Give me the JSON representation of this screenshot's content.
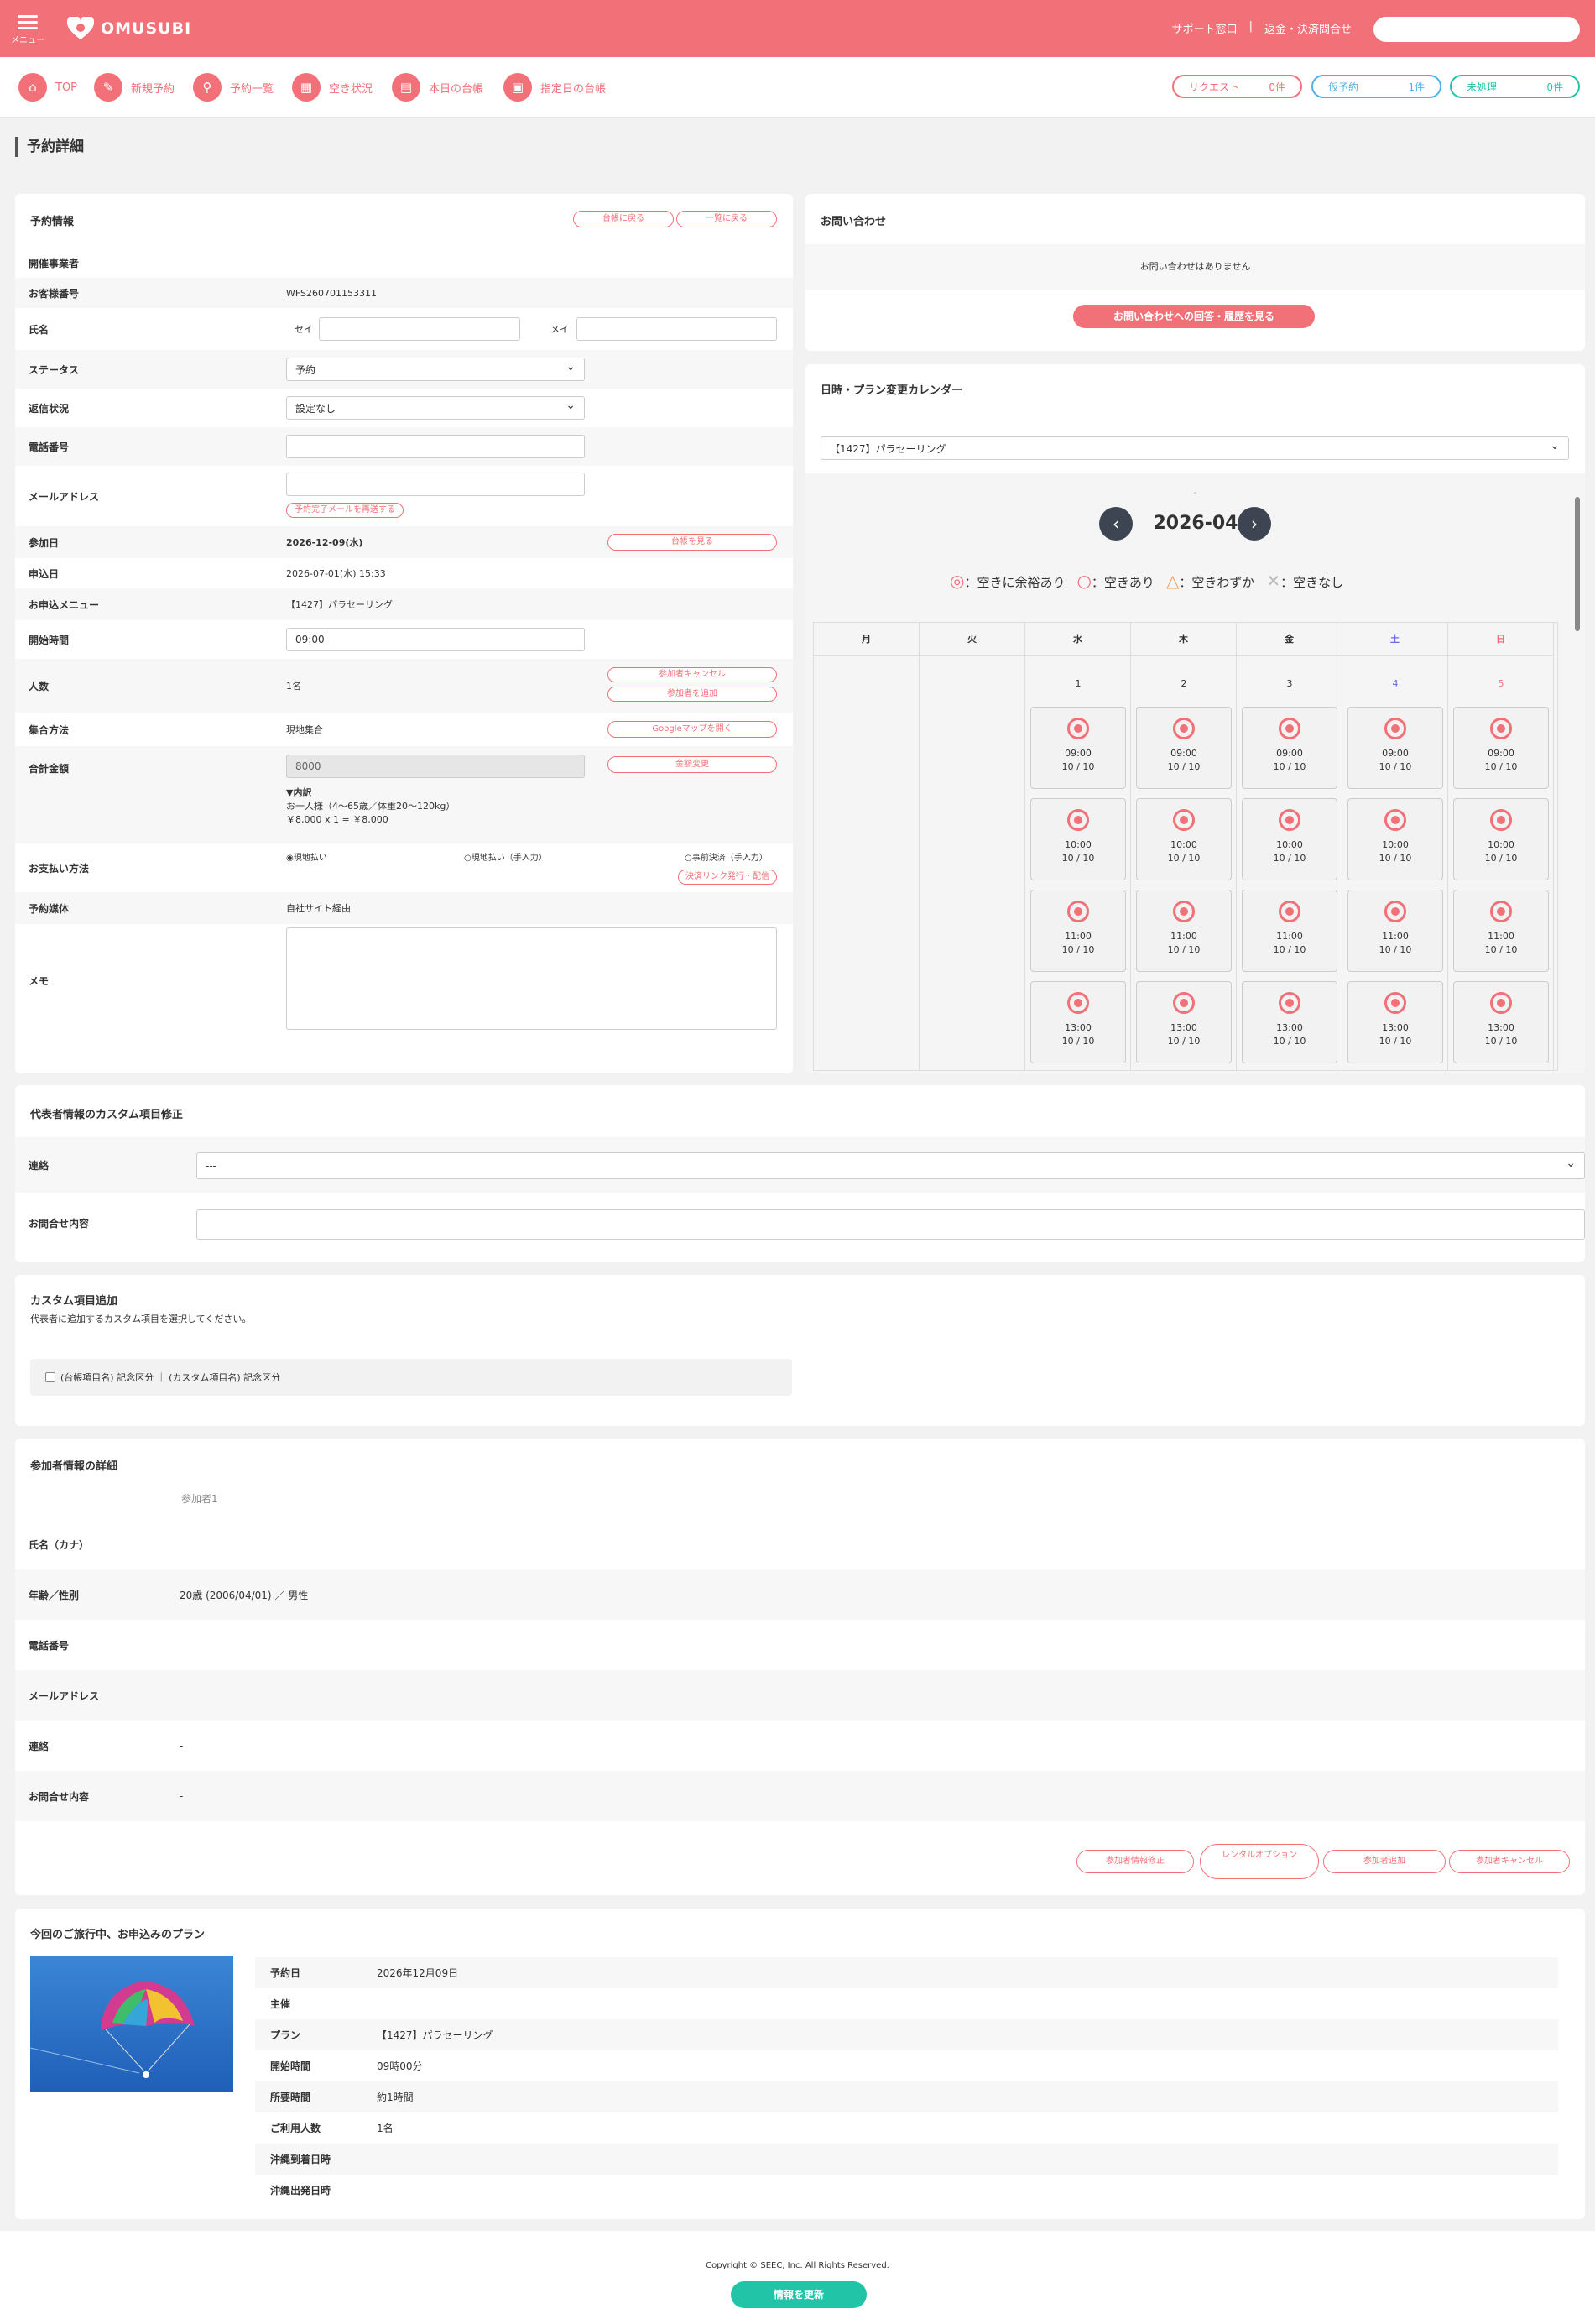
{
  "header": {
    "menu_label": "メニュー",
    "logo_text": "OMUSUBI",
    "support_link": "サポート窓口",
    "separator": "|",
    "refund_link": "返金・決済問合せ",
    "search_placeholder": ""
  },
  "nav": [
    {
      "label": "TOP",
      "icon": "home-icon"
    },
    {
      "label": "新規予約",
      "icon": "edit-icon"
    },
    {
      "label": "予約一覧",
      "icon": "search-icon"
    },
    {
      "label": "空き状況",
      "icon": "grid-icon"
    },
    {
      "label": "本日の台帳",
      "icon": "book-icon"
    },
    {
      "label": "指定日の台帳",
      "icon": "calendar-icon"
    }
  ],
  "badges": [
    {
      "label": "リクエスト",
      "count": "0件",
      "color": "#f27077"
    },
    {
      "label": "仮予約",
      "count": "1件",
      "color": "#4db3e6"
    },
    {
      "label": "未処理",
      "count": "0件",
      "color": "#22c4a8"
    }
  ],
  "page_title": "予約詳細",
  "reservation": {
    "heading": "予約情報",
    "back_ledger": "台帳に戻る",
    "back_list": "一覧に戻る",
    "organizer_label": "開催事業者",
    "customer_no_label": "お客様番号",
    "customer_no": "WFS260701153311",
    "name_label": "氏名",
    "sei_label": "セイ",
    "mei_label": "メイ",
    "status_label": "ステータス",
    "status_value": "予約",
    "reply_label": "返信状況",
    "reply_value": "設定なし",
    "phone_label": "電話番号",
    "email_label": "メールアドレス",
    "resend_mail": "予約完了メールを再送する",
    "date_label": "参加日",
    "date_value": "2026-12-09(水)",
    "see_ledger": "台帳を見る",
    "apply_label": "申込日",
    "apply_value": "2026-07-01(水) 15:33",
    "menu_label": "お申込メニュー",
    "menu_value": "【1427】パラセーリング",
    "start_label": "開始時間",
    "start_value": "09:00",
    "people_label": "人数",
    "people_value": "1名",
    "cancel_participant": "参加者キャンセル",
    "add_participant": "参加者を追加",
    "meet_label": "集合方法",
    "meet_value": "現地集合",
    "google_map": "Googleマップを開く",
    "total_label": "合計金額",
    "total_value": "8000",
    "change_price": "金額変更",
    "breakdown_title": "▼内訳",
    "breakdown_line1": "お一人様（4〜65歳／体重20〜120kg）",
    "breakdown_line2": "￥8,000 x 1 = ￥8,000",
    "pay_label": "お支払い方法",
    "pay_opt1": "現地払い",
    "pay_opt2": "現地払い（手入力）",
    "pay_opt3": "事前決済（手入力）",
    "pay_link": "決済リンク発行・配信",
    "media_label": "予約媒体",
    "media_value": "自社サイト経由",
    "memo_label": "メモ"
  },
  "inquiry": {
    "heading": "お問い合わせ",
    "empty": "お問い合わせはありません",
    "button": "お問い合わせへの回答・履歴を見る"
  },
  "calendar": {
    "heading": "日時・プラン変更カレンダー",
    "plan_select": "【1427】パラセーリング",
    "dash": "-",
    "month": "2026-04",
    "legend": [
      {
        "symbol": "◎",
        "text": "：空きに余裕あり"
      },
      {
        "symbol": "○",
        "text": "：空きあり"
      },
      {
        "symbol": "△",
        "text": "：空きわずか"
      },
      {
        "symbol": "✕",
        "text": "：空きなし"
      }
    ],
    "weekdays": [
      "月",
      "火",
      "水",
      "木",
      "金",
      "土",
      "日"
    ],
    "dates": [
      "1",
      "2",
      "3",
      "4",
      "5"
    ],
    "slots": [
      {
        "time": "09:00",
        "capacity": "10 / 10"
      },
      {
        "time": "10:00",
        "capacity": "10 / 10"
      },
      {
        "time": "11:00",
        "capacity": "10 / 10"
      },
      {
        "time": "13:00",
        "capacity": "10 / 10"
      }
    ]
  },
  "custom_rep": {
    "heading": "代表者情報のカスタム項目修正",
    "contact_label": "連絡",
    "contact_value": "---",
    "inquiry_label": "お問合せ内容"
  },
  "custom_add": {
    "heading": "カスタム項目追加",
    "desc": "代表者に追加するカスタム項目を選択してください。",
    "option": "(台帳項目名) 記念区分 ｜ (カスタム項目名) 記念区分"
  },
  "participants": {
    "heading": "参加者情報の詳細",
    "participant": "参加者1",
    "rows": [
      {
        "label": "氏名（カナ）",
        "value": ""
      },
      {
        "label": "年齢／性別",
        "value": "20歳 (2006/04/01) ／ 男性"
      },
      {
        "label": "電話番号",
        "value": ""
      },
      {
        "label": "メールアドレス",
        "value": ""
      },
      {
        "label": "連絡",
        "value": "-"
      },
      {
        "label": "お問合せ内容",
        "value": "-"
      }
    ],
    "buttons": [
      "参加者情報修正",
      "レンタルオプション",
      "参加者追加",
      "参加者キャンセル"
    ]
  },
  "plan": {
    "heading": "今回のご旅行中、お申込みのプラン",
    "rows": [
      {
        "label": "予約日",
        "value": "2026年12月09日"
      },
      {
        "label": "主催",
        "value": ""
      },
      {
        "label": "プラン",
        "value": "【1427】パラセーリング"
      },
      {
        "label": "開始時間",
        "value": "09時00分"
      },
      {
        "label": "所要時間",
        "value": "約1時間"
      },
      {
        "label": "ご利用人数",
        "value": "1名"
      },
      {
        "label": "沖縄到着日時",
        "value": ""
      },
      {
        "label": "沖縄出発日時",
        "value": ""
      }
    ]
  },
  "footer": {
    "copyright": "Copyright © SEEC, Inc. All Rights Reserved.",
    "update_button": "情報を更新"
  }
}
